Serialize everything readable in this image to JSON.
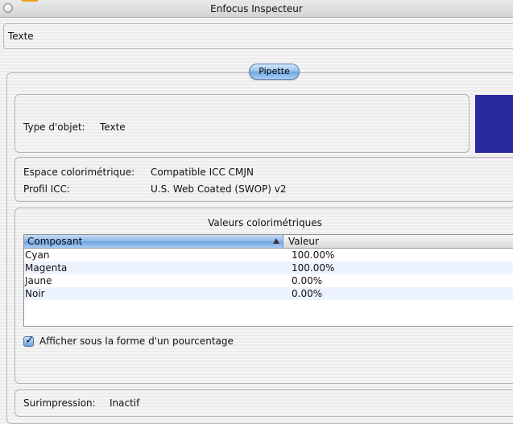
{
  "window": {
    "title": "Enfocus Inspecteur"
  },
  "header": {
    "label": "Texte"
  },
  "pipette": {
    "button_label": "Pipette"
  },
  "object_type": {
    "label": "Type d'objet:",
    "value": "Texte",
    "swatch_color": "#2a2aa0"
  },
  "color_space": {
    "space_label": "Espace colorimétrique:",
    "space_value": "Compatible ICC CMJN",
    "profile_label": "Profil ICC:",
    "profile_value": "U.S. Web Coated (SWOP) v2"
  },
  "values": {
    "title": "Valeurs colorimétriques",
    "columns": {
      "component": "Composant",
      "value": "Valeur"
    },
    "rows": [
      {
        "name": "Cyan",
        "value": "100.00%"
      },
      {
        "name": "Magenta",
        "value": "100.00%"
      },
      {
        "name": "Jaune",
        "value": "0.00%"
      },
      {
        "name": "Noir",
        "value": "0.00%"
      }
    ],
    "percent_checkbox": {
      "label": "Afficher sous la forme d'un pourcentage",
      "checked": true
    }
  },
  "overprint": {
    "label": "Surimpression:",
    "value": "Inactif"
  }
}
